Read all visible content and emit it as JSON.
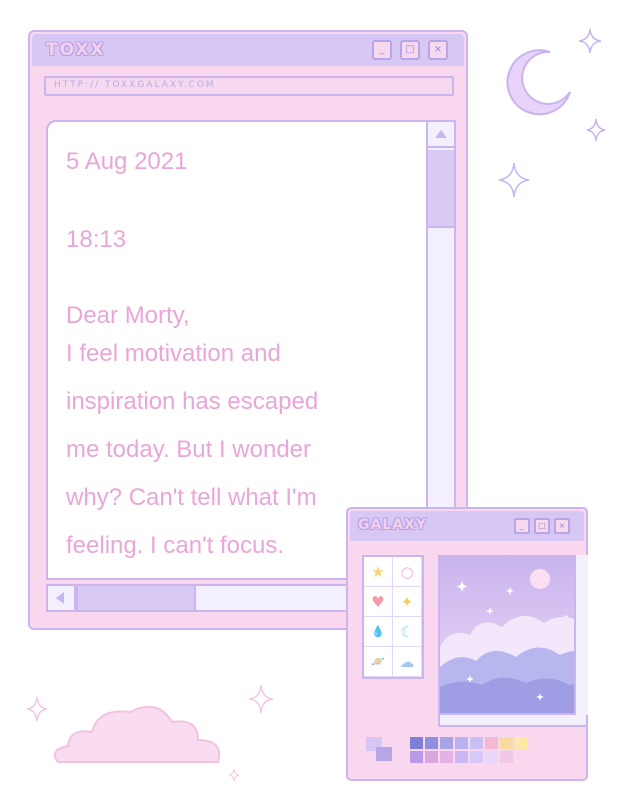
{
  "main_window": {
    "title": "TOXX",
    "address": "HTTP:// TOXXGALAXY.COM",
    "controls": {
      "minimize": "_",
      "maximize": "□",
      "close": "×"
    },
    "note_lines": [
      "5 Aug 2021",
      "18:13",
      "Dear Morty,",
      "I feel motivation and",
      "inspiration has escaped",
      "me today. But I wonder",
      "why? Can't tell what I'm",
      "feeling. I can't focus."
    ]
  },
  "galaxy_window": {
    "title": "GALAXY",
    "controls": {
      "minimize": "_",
      "maximize": "□",
      "close": "×"
    },
    "palette_icons": [
      "star-icon",
      "circle-icon",
      "heart-icon",
      "sparkle-icon",
      "drop-icon",
      "moon-icon",
      "planet-icon",
      "cloud-icon"
    ],
    "palette_glyphs": [
      "★",
      "○",
      "♥",
      "✦",
      "💧",
      "☾",
      "🪐",
      "☁"
    ]
  },
  "colors": {
    "window_bg": "#f9d8ef",
    "titlebar": "#d7c7f4",
    "border": "#cbb5ee",
    "text": "#e9a6d8",
    "moon": "#e8d3fb"
  },
  "swatch_colors": [
    "#7f7fd6",
    "#8f8fe0",
    "#a6a3e8",
    "#b9b2f0",
    "#c9bff4",
    "#f3b8d3",
    "#f8dba0",
    "#fbe9a6",
    "#b89be6",
    "#d9a6dd",
    "#e6b2e3",
    "#c9b8f2",
    "#d6c8f7",
    "#e7d7fa",
    "#f1c7e6",
    "#fbd7ee"
  ]
}
